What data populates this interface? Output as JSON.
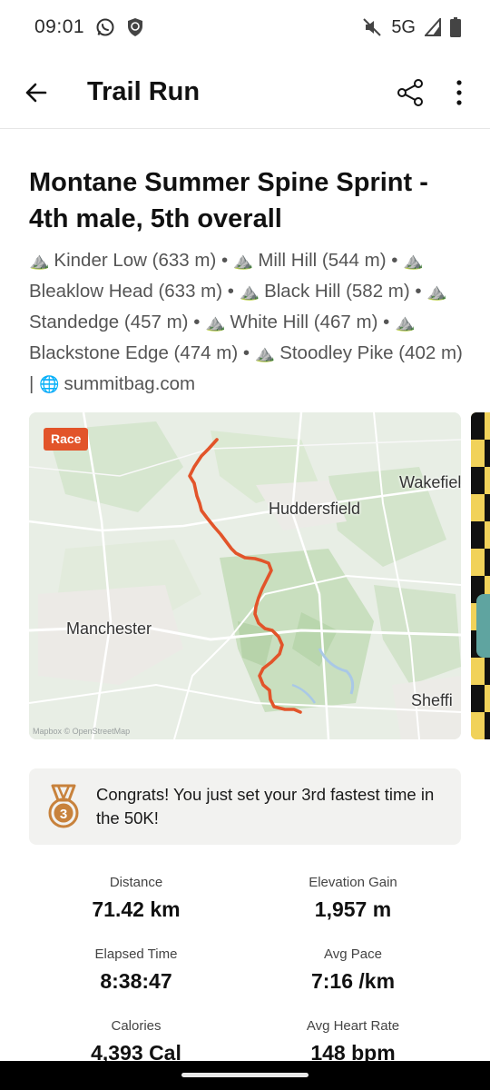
{
  "status_bar": {
    "time": "09:01",
    "network": "5G",
    "icons": [
      "whatsapp-icon",
      "shield-icon",
      "mute-icon",
      "signal-icon",
      "battery-icon"
    ]
  },
  "app_bar": {
    "title": "Trail Run",
    "icons": [
      "back-arrow-icon",
      "share-icon",
      "more-vertical-icon"
    ]
  },
  "activity": {
    "title": "Montane Summer Spine Sprint - 4th male, 5th overall",
    "peak_icon": "⛰️",
    "globe_icon": "🌐",
    "description_parts": [
      "Kinder Low (633 m)",
      "Mill Hill (544 m)",
      "Bleaklow Head (633 m)",
      "Black Hill (582 m)",
      "Standedge (457 m)",
      "White Hill (467 m)",
      "Blackstone Edge (474 m)",
      "Stoodley Pike (402 m)"
    ],
    "separator": " • ",
    "pipe": " | ",
    "link": "summitbag.com"
  },
  "map": {
    "badge": "Race",
    "labels": {
      "manchester": "Manchester",
      "huddersfield": "Huddersfield",
      "wakefield": "Wakefiel",
      "sheffield": "Sheffi"
    },
    "attribution": "Mapbox © OpenStreetMap",
    "route_color": "#e2542a"
  },
  "achievement": {
    "icon": "medal-icon",
    "medal_number": "3",
    "text": "Congrats! You just set your 3rd fastest time in the 50K!"
  },
  "stats": {
    "distance": {
      "label": "Distance",
      "value": "71.42 km"
    },
    "elevation_gain": {
      "label": "Elevation Gain",
      "value": "1,957 m"
    },
    "elapsed_time": {
      "label": "Elapsed Time",
      "value": "8:38:47"
    },
    "avg_pace": {
      "label": "Avg Pace",
      "value": "7:16 /km"
    },
    "calories": {
      "label": "Calories",
      "value": "4,393 Cal"
    },
    "avg_heart_rate": {
      "label": "Avg Heart Rate",
      "value": "148 bpm"
    }
  },
  "colors": {
    "accent": "#e2542a",
    "medal": "#c8823c",
    "card_bg": "#f2f2f0"
  }
}
